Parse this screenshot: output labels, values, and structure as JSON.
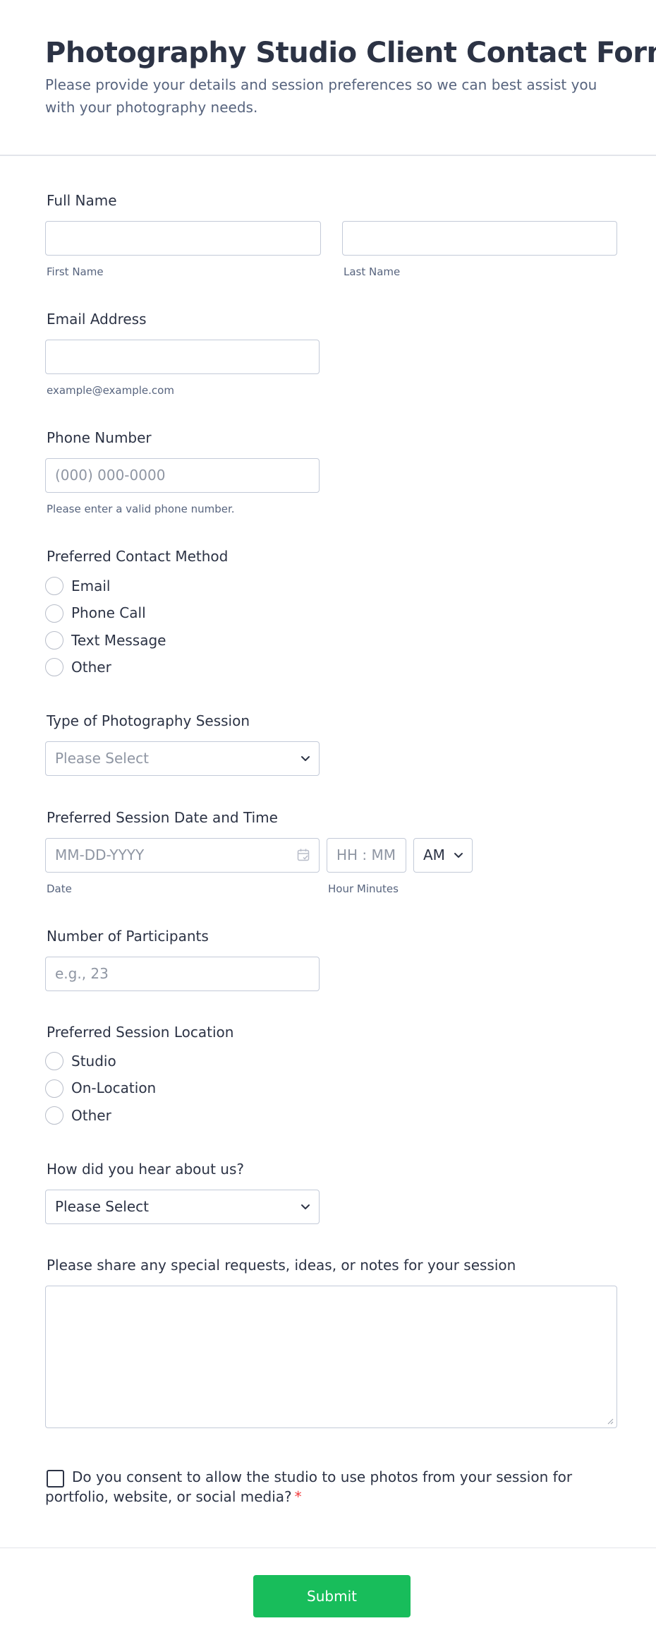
{
  "header": {
    "title": "Photography Studio Client Contact Form",
    "subtitle": "Please provide your details and session preferences so we can best assist you with your photography needs."
  },
  "full_name": {
    "label": "Full Name",
    "first_sublabel": "First Name",
    "last_sublabel": "Last Name"
  },
  "email": {
    "label": "Email Address",
    "sublabel": "example@example.com"
  },
  "phone": {
    "label": "Phone Number",
    "placeholder": "(000) 000-0000",
    "sublabel": "Please enter a valid phone number."
  },
  "contact_method": {
    "label": "Preferred Contact Method",
    "options": [
      "Email",
      "Phone Call",
      "Text Message",
      "Other"
    ]
  },
  "session_type": {
    "label": "Type of Photography Session",
    "selected": "Please Select"
  },
  "session_datetime": {
    "label": "Preferred Session Date and Time",
    "date_placeholder": "MM-DD-YYYY",
    "time_placeholder": "HH : MM",
    "ampm": "AM",
    "date_sublabel": "Date",
    "time_sublabel": "Hour Minutes"
  },
  "participants": {
    "label": "Number of Participants",
    "placeholder": "e.g., 23"
  },
  "location": {
    "label": "Preferred Session Location",
    "options": [
      "Studio",
      "On-Location",
      "Other"
    ]
  },
  "referral": {
    "label": "How did you hear about us?",
    "selected": "Please Select"
  },
  "notes": {
    "label": "Please share any special requests, ideas, or notes for your session"
  },
  "consent": {
    "text": "Do you consent to allow the studio to use photos from your session for portfolio, website, or social media?",
    "required_mark": "*"
  },
  "submit": {
    "label": "Submit"
  },
  "colors": {
    "accent": "#18bd5b",
    "text": "#2c3345",
    "muted": "#57647e",
    "placeholder": "#8f96a3",
    "border": "#c3cad8",
    "required": "#f23a3c"
  }
}
